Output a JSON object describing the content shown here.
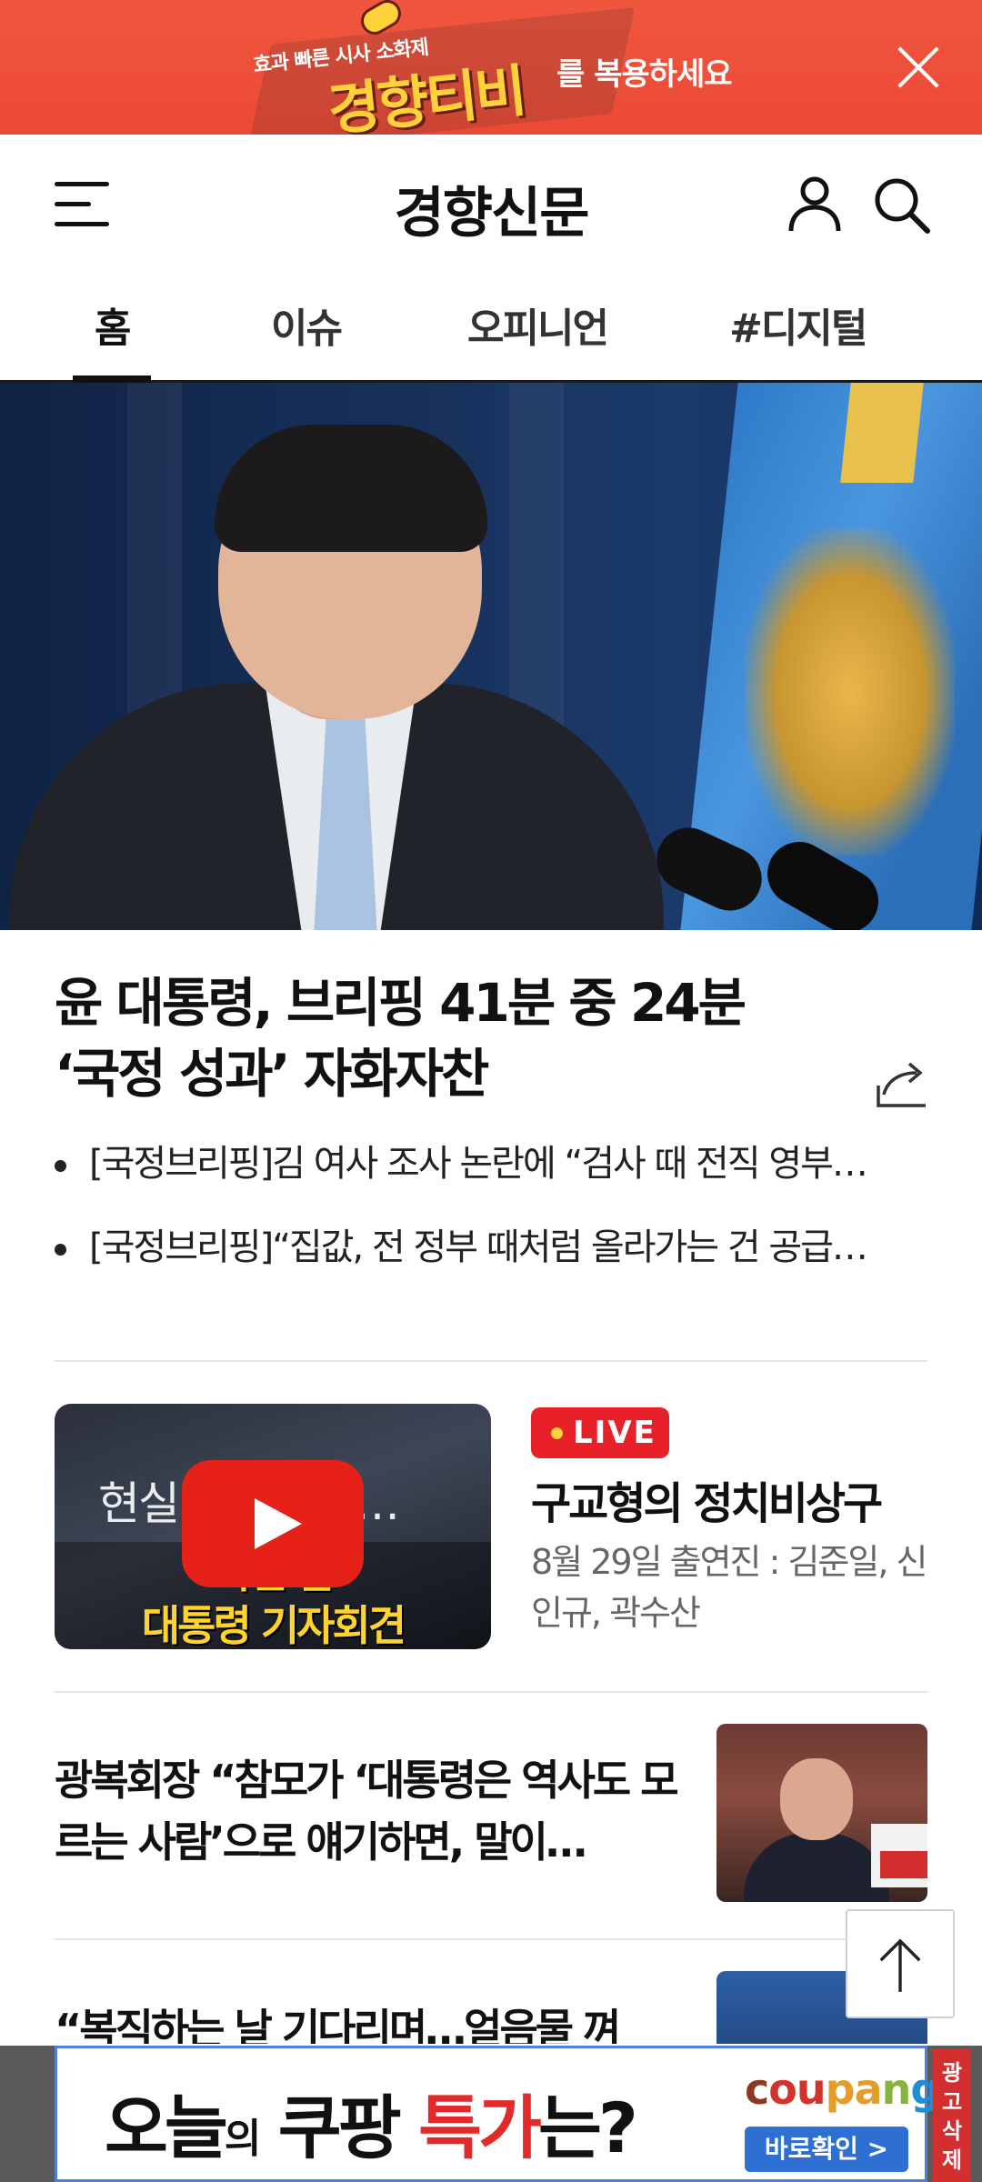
{
  "top_banner": {
    "small_text": "효과 빠른 시사 소화제",
    "brand_text": "경향티비",
    "tail_text": "를 복용하세요"
  },
  "header": {
    "logo": "경향신문"
  },
  "tabs": [
    {
      "label": "홈"
    },
    {
      "label": "이슈"
    },
    {
      "label": "오피니언"
    },
    {
      "label": "#디지털"
    }
  ],
  "headline": {
    "line1": "윤 대통령, 브리핑 41분 중 24분",
    "line2": "‘국정 성과’ 자화자찬",
    "related": [
      "[국정브리핑]김 여사 조사 논란에 “검사 때 전직 영부…",
      "[국정브리핑]“집값, 전 정부 때처럼 올라가는 건 공급…"
    ]
  },
  "video": {
    "thumb_text_top": "현실",
    "thumb_text_top2": "감…",
    "thumb_text_mid": "국민 한",
    "thumb_text_bottom": "대통령 기자회견",
    "live_label": "LIVE",
    "title": "구교형의 정치비상구",
    "desc": "8월 29일 출연진 : 김준일, 신인규, 곽수산"
  },
  "news": [
    {
      "title": "광복회장 “참모가 ‘대통령은 역사도 모르는 사람’으로 얘기하면, 말이…"
    },
    {
      "title": "“복직하는 날 기다리며…얼음물 껴"
    }
  ],
  "bottom_ad": {
    "main_part1": "오늘",
    "main_small": "의",
    "main_part2": " 쿠팡 ",
    "main_red": "특가",
    "main_part3": "는?",
    "brand": [
      "c",
      "ou",
      "pa",
      "n",
      "g"
    ],
    "cta": "바로확인 >",
    "remove_label": "광고삭제"
  },
  "colors": {
    "banner_bg": "#ec4a36",
    "live_red": "#e8202a",
    "ad_red": "#d32f2f",
    "youtube_red": "#e62117"
  }
}
